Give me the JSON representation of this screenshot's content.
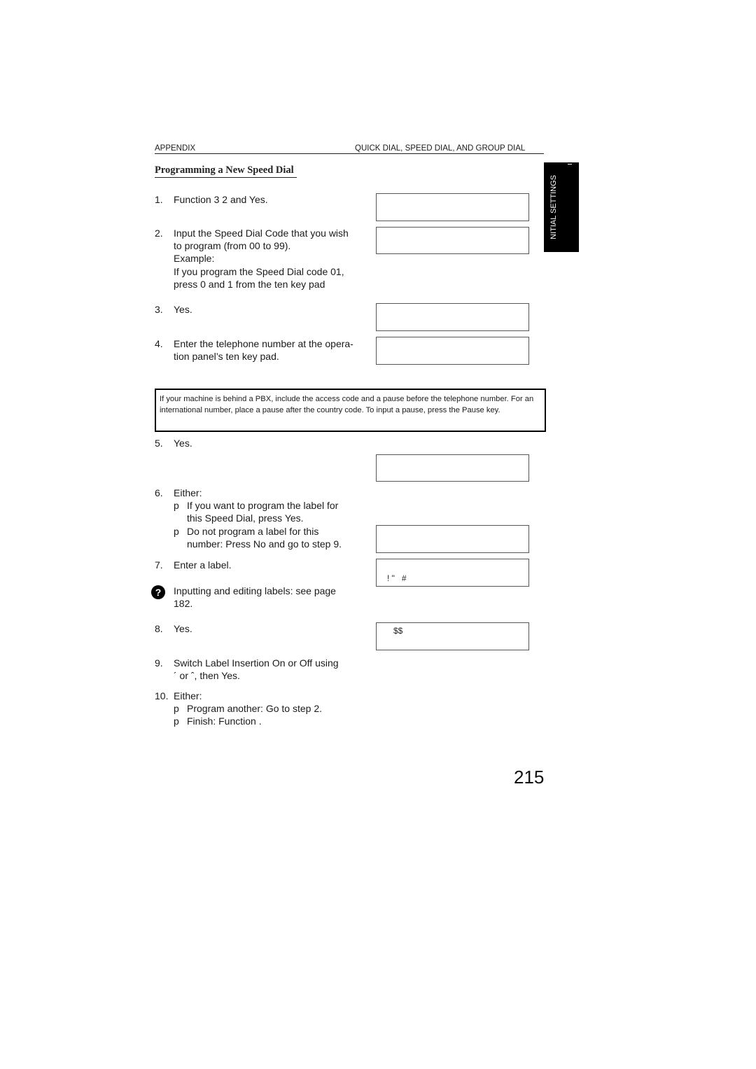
{
  "header": {
    "left": "APPENDIX",
    "right": "QUICK DIAL, SPEED DIAL, AND GROUP DIAL"
  },
  "side_tab": {
    "label": "NITIAL SETTINGS"
  },
  "section_title": "Programming a New Speed Dial",
  "steps": [
    {
      "num": "1.",
      "lines": [
        "Function 3 2  and Yes."
      ]
    },
    {
      "num": "2.",
      "lines": [
        "Input the Speed Dial Code that you wish",
        "to program (from 00 to 99).",
        "Example:",
        "If you program the Speed Dial code 01,",
        "press 0 and 1 from the ten key pad"
      ]
    },
    {
      "num": "3.",
      "lines": [
        "Yes."
      ]
    },
    {
      "num": "4.",
      "lines": [
        "Enter the telephone number at the opera-",
        "tion panel’s ten key pad."
      ]
    },
    {
      "num": "5.",
      "lines": [
        "Yes."
      ]
    },
    {
      "num": "6.",
      "lines": [
        "Either:"
      ],
      "bullets": [
        {
          "marker": "p",
          "lines": [
            "If you want to program the label for",
            "this Speed Dial, press Yes."
          ]
        },
        {
          "marker": "p",
          "lines": [
            "Do not program a label for this",
            "number: Press No and go to step 9."
          ]
        }
      ]
    },
    {
      "num": "7.",
      "lines": [
        "Enter a label."
      ]
    },
    {
      "num": "8.",
      "lines": [
        "Yes."
      ]
    },
    {
      "num": "9.",
      "lines": [
        "Switch Label Insertion On or Off using",
        "´ or ˆ, then Yes."
      ]
    },
    {
      "num": "10.",
      "lines": [
        "Either:"
      ],
      "bullets": [
        {
          "marker": "p",
          "lines": [
            "Program another: Go to step 2."
          ]
        },
        {
          "marker": "p",
          "lines": [
            "Finish: Function ."
          ]
        }
      ]
    }
  ],
  "tip": {
    "icon": "?",
    "lines": [
      "Inputting and editing labels: see page",
      "182."
    ]
  },
  "note": "If your machine is behind a PBX, include the access code and a pause before the telephone number. For an international number, place a pause after the country code. To input a pause, press the Pause key.",
  "lcd_displays": [
    {
      "text": ""
    },
    {
      "text": ""
    },
    {
      "text": ""
    },
    {
      "text": ""
    },
    {
      "text": ""
    },
    {
      "text": ""
    },
    {
      "text": "! \"   #"
    },
    {
      "text": "$$"
    }
  ],
  "page_number": "215"
}
